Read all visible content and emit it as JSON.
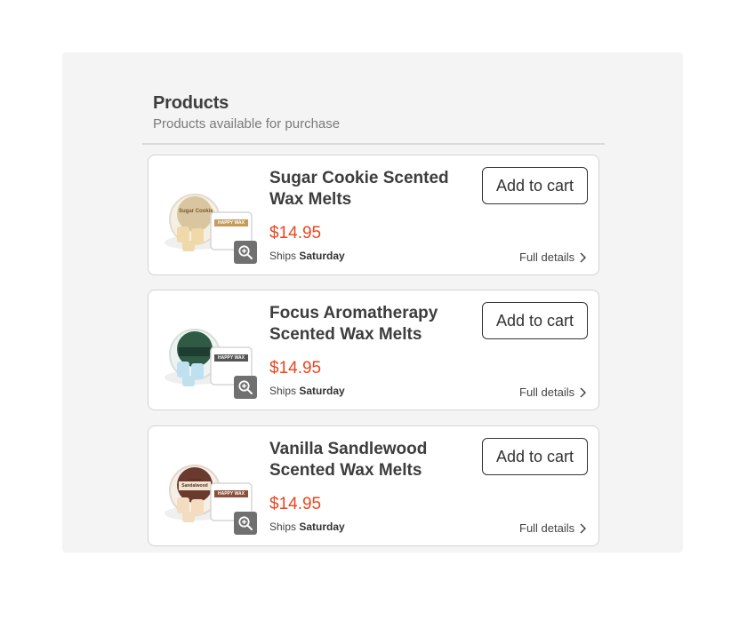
{
  "header": {
    "title": "Products",
    "subtitle": "Products available for purchase"
  },
  "products": [
    {
      "name": "Sugar Cookie Scented Wax Melts",
      "price": "$14.95",
      "ships_prefix": "Ships",
      "ships_day": "Saturday",
      "add_label": "Add to cart",
      "details_label": "Full details",
      "image_label": "Sugar Cookie",
      "image_brand": "HAPPY WAX",
      "colors": {
        "lid": "#d9c6a0",
        "melts": "#f0d9a8",
        "band": "#c79b5a"
      }
    },
    {
      "name": "Focus Aromatherapy Scented Wax Melts",
      "price": "$14.95",
      "ships_prefix": "Ships",
      "ships_day": "Saturday",
      "add_label": "Add to cart",
      "details_label": "Full details",
      "image_label": "",
      "image_brand": "HAPPY WAX",
      "colors": {
        "lid": "#2f5a46",
        "melts": "#bfe0ef",
        "band": "#1e3d31"
      }
    },
    {
      "name": "Vanilla Sandlewood Scented Wax Melts",
      "price": "$14.95",
      "ships_prefix": "Ships",
      "ships_day": "Saturday",
      "add_label": "Add to cart",
      "details_label": "Full details",
      "image_label": "Vanilla Sandalwood",
      "image_brand": "HAPPY WAX",
      "colors": {
        "lid": "#6b3a2e",
        "melts": "#f3dcc0",
        "band": "#8c4f3a"
      }
    }
  ],
  "theme": {
    "price_color": "#e8461e",
    "panel_bg": "#f4f4f4"
  }
}
